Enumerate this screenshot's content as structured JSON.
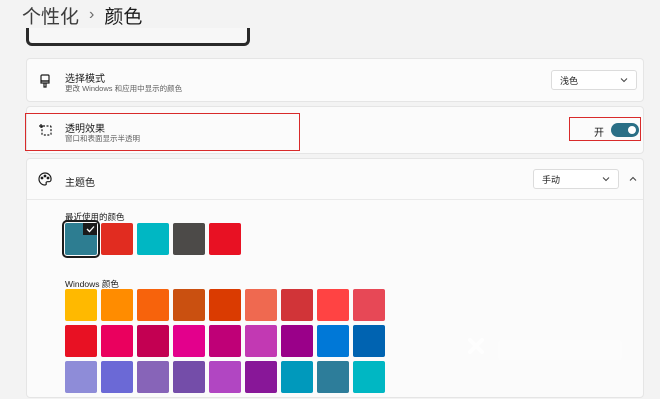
{
  "breadcrumb": {
    "parent": "个性化",
    "separator": "›",
    "current": "颜色"
  },
  "mode": {
    "title": "选择模式",
    "subtitle": "更改 Windows 和应用中显示的颜色",
    "value": "浅色",
    "icon": "brush-icon"
  },
  "transparency": {
    "title": "透明效果",
    "subtitle": "窗口和表面显示半透明",
    "toggle_label": "开",
    "toggle_on": true,
    "icon": "transparency-icon"
  },
  "accent": {
    "title": "主题色",
    "value": "手动",
    "icon": "palette-icon",
    "recent_label": "最近使用的颜色",
    "windows_label": "Windows 颜色",
    "recent_colors": [
      "#2d7d91",
      "#e12c20",
      "#00b7c3",
      "#4c4a48",
      "#e81123"
    ],
    "selected_recent_index": 0,
    "windows_colors": [
      [
        "#ffb900",
        "#ff8c00",
        "#f7630c",
        "#ca5010",
        "#da3b01",
        "#ef6950",
        "#d13438",
        "#ff4343",
        "#e74856"
      ],
      [
        "#e81123",
        "#ea005e",
        "#c30052",
        "#e3008c",
        "#bf0077",
        "#c239b3",
        "#9a0089",
        "#0078d7",
        "#0063b1"
      ],
      [
        "#8e8cd8",
        "#6b69d6",
        "#8764b8",
        "#744da9",
        "#b146c2",
        "#881798",
        "#0099bc",
        "#2d7d9a",
        "#00b7c3"
      ]
    ]
  },
  "colors": {
    "accent": "#2a6f86",
    "highlight_box": "#d82a2a"
  }
}
